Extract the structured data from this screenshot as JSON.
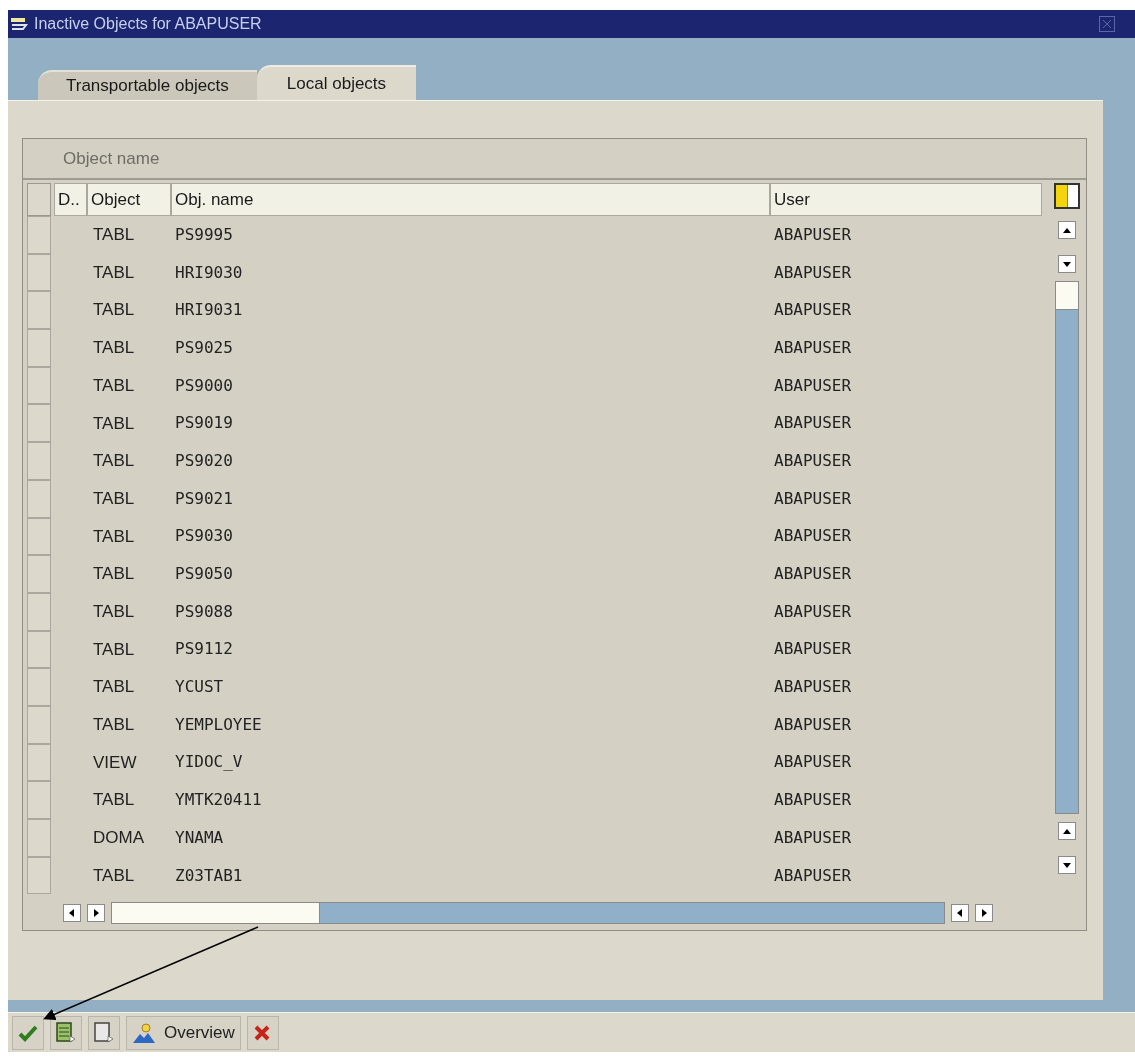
{
  "window": {
    "title": "Inactive Objects for ABAPUSER"
  },
  "tabs": [
    {
      "label": "Transportable objects",
      "selected": false
    },
    {
      "label": "Local objects",
      "selected": true
    }
  ],
  "table": {
    "group_header": "Object name",
    "columns": [
      "D..",
      "Object",
      "Obj. name",
      "User"
    ],
    "rows": [
      {
        "object": "TABL",
        "obj_name": "PS9995",
        "user": "ABAPUSER"
      },
      {
        "object": "TABL",
        "obj_name": "HRI9030",
        "user": "ABAPUSER"
      },
      {
        "object": "TABL",
        "obj_name": "HRI9031",
        "user": "ABAPUSER"
      },
      {
        "object": "TABL",
        "obj_name": "PS9025",
        "user": "ABAPUSER"
      },
      {
        "object": "TABL",
        "obj_name": "PS9000",
        "user": "ABAPUSER"
      },
      {
        "object": "TABL",
        "obj_name": "PS9019",
        "user": "ABAPUSER"
      },
      {
        "object": "TABL",
        "obj_name": "PS9020",
        "user": "ABAPUSER"
      },
      {
        "object": "TABL",
        "obj_name": "PS9021",
        "user": "ABAPUSER"
      },
      {
        "object": "TABL",
        "obj_name": "PS9030",
        "user": "ABAPUSER"
      },
      {
        "object": "TABL",
        "obj_name": "PS9050",
        "user": "ABAPUSER"
      },
      {
        "object": "TABL",
        "obj_name": "PS9088",
        "user": "ABAPUSER"
      },
      {
        "object": "TABL",
        "obj_name": "PS9112",
        "user": "ABAPUSER"
      },
      {
        "object": "TABL",
        "obj_name": "YCUST",
        "user": "ABAPUSER"
      },
      {
        "object": "TABL",
        "obj_name": "YEMPLOYEE",
        "user": "ABAPUSER"
      },
      {
        "object": "VIEW",
        "obj_name": "YIDOC_V",
        "user": "ABAPUSER"
      },
      {
        "object": "TABL",
        "obj_name": "YMTK20411",
        "user": "ABAPUSER"
      },
      {
        "object": "DOMA",
        "obj_name": "YNAMA",
        "user": "ABAPUSER"
      },
      {
        "object": "TABL",
        "obj_name": "Z03TAB1",
        "user": "ABAPUSER"
      }
    ]
  },
  "toolbar": [
    {
      "kind": "check"
    },
    {
      "kind": "select-all"
    },
    {
      "kind": "deselect"
    },
    {
      "kind": "overview",
      "label": "Overview"
    },
    {
      "kind": "cancel"
    }
  ]
}
